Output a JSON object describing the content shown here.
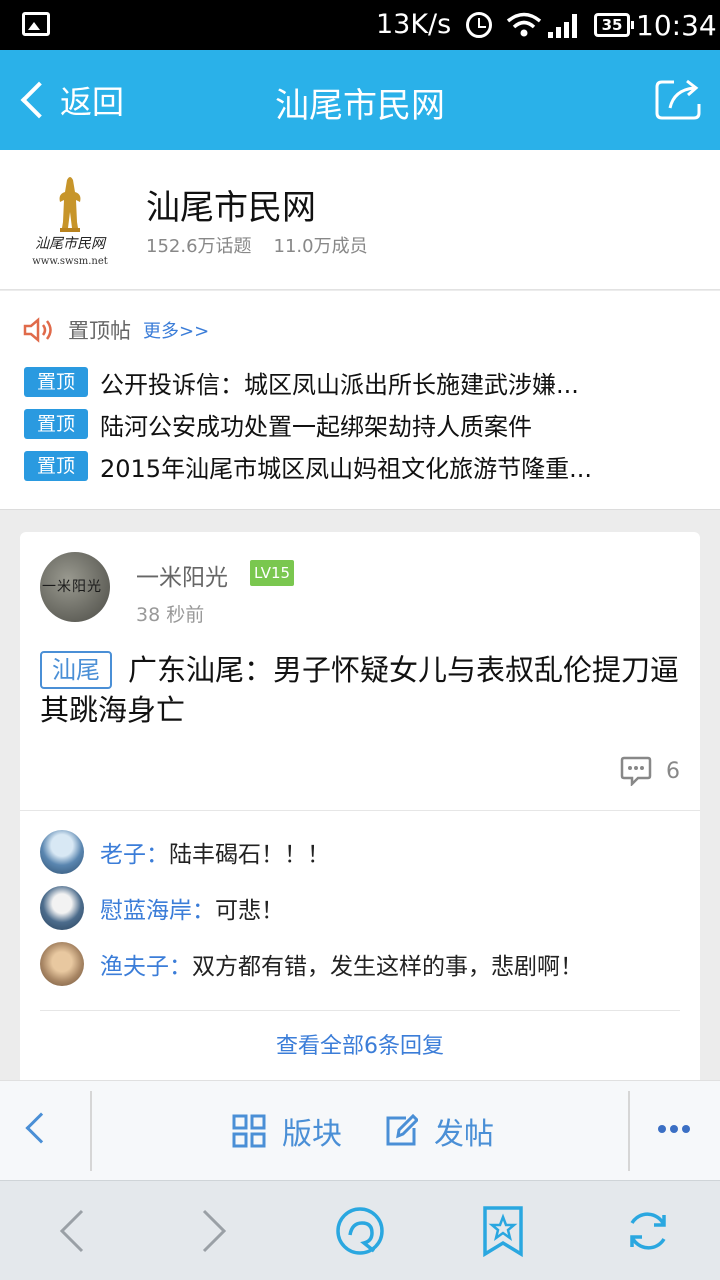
{
  "status_bar": {
    "net_speed": "13K/s",
    "battery": "35",
    "time": "10:34",
    "icons": [
      "image-icon",
      "alarm-icon",
      "wifi-icon",
      "signal-icon",
      "battery-icon"
    ]
  },
  "nav": {
    "back_label": "返回",
    "title": "汕尾市民网",
    "share_icon": "share-icon"
  },
  "forum": {
    "name": "汕尾市民网",
    "logo_text": "汕尾市民网",
    "logo_url_text": "www.swsm.net",
    "topics": "152.6万话题",
    "members": "11.0万成员"
  },
  "pinned": {
    "label": "置顶帖",
    "more": "更多>>",
    "badge": "置顶",
    "items": [
      "公开投诉信：城区凤山派出所长施建武涉嫌...",
      "陆河公安成功处置一起绑架劫持人质案件",
      "2015年汕尾市城区凤山妈祖文化旅游节隆重..."
    ]
  },
  "post": {
    "author": "一米阳光",
    "level": "LV15",
    "time": "38 秒前",
    "tag": "汕尾",
    "title": "广东汕尾：男子怀疑女儿与表叔乱伦提刀逼其跳海身亡",
    "comment_count": "6",
    "replies": [
      {
        "name": "老子",
        "text": "陆丰碣石！！！"
      },
      {
        "name": "慰蓝海岸",
        "text": "可悲！"
      },
      {
        "name": "渔夫子",
        "text": "双方都有错，发生这样的事，悲剧啊！"
      }
    ],
    "view_all": "查看全部6条回复"
  },
  "toolbar": {
    "sections_label": "版块",
    "post_label": "发帖"
  },
  "colors": {
    "nav_bg": "#2ab1e9",
    "accent_blue": "#3b7dd8",
    "badge_blue": "#2a9ae0",
    "level_green": "#7ac74f"
  }
}
